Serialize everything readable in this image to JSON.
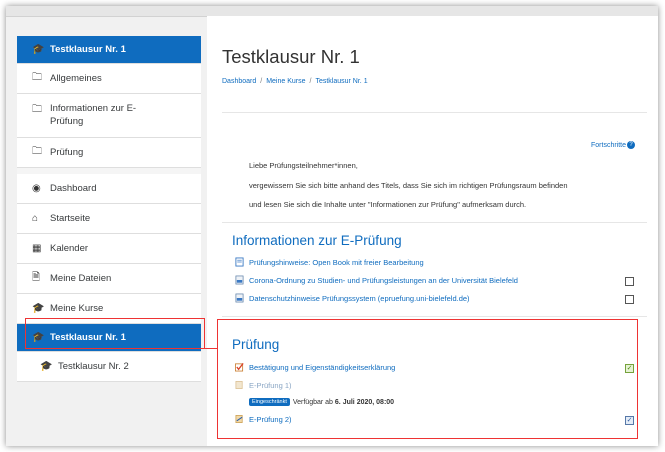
{
  "sidebar": {
    "items": [
      {
        "icon": "graduation-cap-icon",
        "label": "Testklausur Nr. 1"
      },
      {
        "icon": "folder-icon",
        "label": "Allgemeines"
      },
      {
        "icon": "folder-icon",
        "label": "Informationen zur E-Prüfung"
      },
      {
        "icon": "folder-icon",
        "label": "Prüfung"
      },
      {
        "icon": "dashboard-icon",
        "label": "Dashboard"
      },
      {
        "icon": "home-icon",
        "label": "Startseite"
      },
      {
        "icon": "calendar-icon",
        "label": "Kalender"
      },
      {
        "icon": "file-icon",
        "label": "Meine Dateien"
      },
      {
        "icon": "graduation-cap-icon",
        "label": "Meine Kurse"
      },
      {
        "icon": "graduation-cap-icon",
        "label": "Testklausur Nr. 1"
      },
      {
        "icon": "graduation-cap-icon",
        "label": "Testklausur Nr. 2"
      }
    ]
  },
  "page": {
    "title": "Testklausur Nr. 1",
    "breadcrumb": [
      "Dashboard",
      "Meine Kurse",
      "Testklausur Nr. 1"
    ],
    "progress_label": "Fortschritte",
    "progress_help": "?"
  },
  "intro": {
    "line1": "Liebe Prüfungsteilnehmer*innen,",
    "line2": "vergewissern Sie sich bitte anhand des Titels, dass Sie sich im richtigen Prüfungsraum befinden",
    "line3": "und lesen Sie sich die Inhalte unter \"Informationen zur Prüfung\" aufmerksam durch."
  },
  "sections": {
    "info": {
      "title": "Informationen zur E-Prüfung",
      "activities": [
        "Prüfungshinweise: Open Book mit freier Bearbeitung",
        "Corona-Ordnung zu Studien- und Prüfungsleistungen an der Universität Bielefeld",
        "Datenschutzhinweise Prüfungssystem (epruefung.uni-bielefeld.de)"
      ]
    },
    "exam": {
      "title": "Prüfung",
      "activities": [
        "Bestätigung und Eigenständigkeitserklärung",
        "E-Prüfung 1)",
        "E-Prüfung 2)"
      ],
      "restriction_badge": "Eingeschränkt",
      "restriction_text": "Verfügbar ab",
      "restriction_date": "6. Juli 2020, 08:00"
    }
  },
  "colors": {
    "brand": "#0f6cbf",
    "highlight": "#ee3333"
  }
}
